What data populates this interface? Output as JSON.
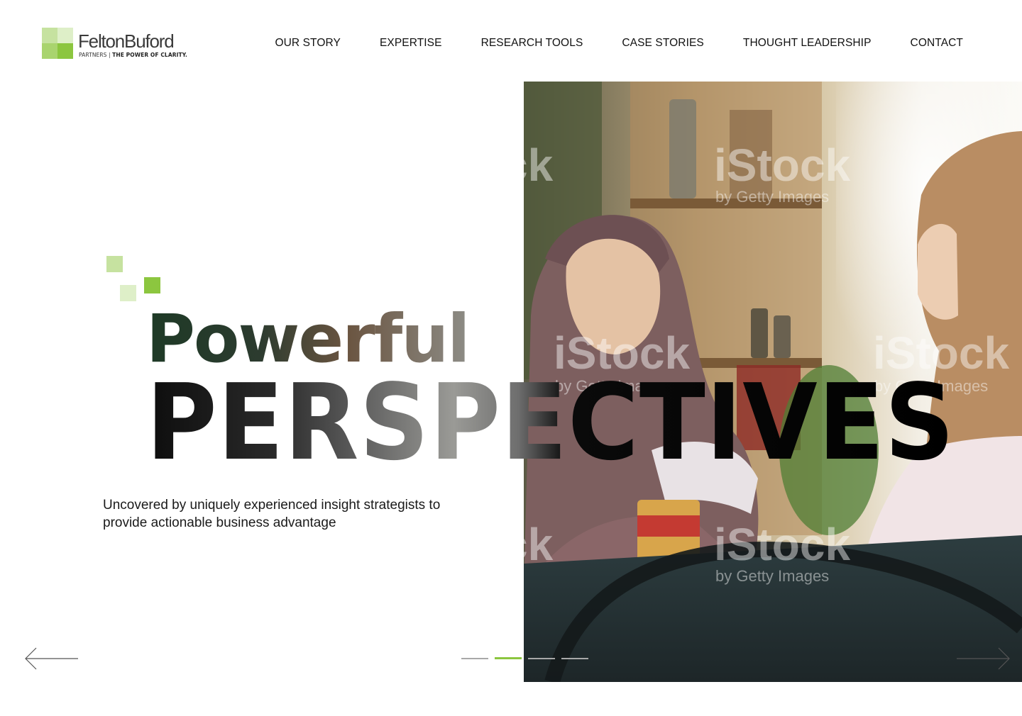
{
  "brand": {
    "name": "FeltonBuford",
    "tagline_left": "PARTNERS |",
    "tagline_right": "THE POWER OF CLARITY.",
    "accent": "#8cc63f",
    "mark_colors": [
      "#8cc63f",
      "#a9d46e",
      "#c6e2a0",
      "#deefc8"
    ]
  },
  "nav": {
    "items": [
      {
        "label": "OUR STORY"
      },
      {
        "label": "EXPERTISE"
      },
      {
        "label": "RESEARCH TOOLS"
      },
      {
        "label": "CASE STORIES"
      },
      {
        "label": "THOUGHT LEADERSHIP"
      },
      {
        "label": "CONTACT"
      }
    ]
  },
  "hero": {
    "headline_line1": "Powerful",
    "headline_line2": "PERSPECTIVES",
    "subtitle": "Uncovered by uniquely experienced insight strategists to provide actionable business advantage",
    "photo_watermark": "iStock",
    "photo_watermark_sub": "by Getty Images",
    "deco_colors": [
      "#c6e2a0",
      "#deefc8",
      "#8cc63f"
    ]
  },
  "slider": {
    "prev_icon": "arrow-left-icon",
    "next_icon": "arrow-right-icon",
    "slide_count": 4,
    "active_index": 1,
    "active_color": "#8cc63f",
    "inactive_color": "#a8a8a8"
  }
}
